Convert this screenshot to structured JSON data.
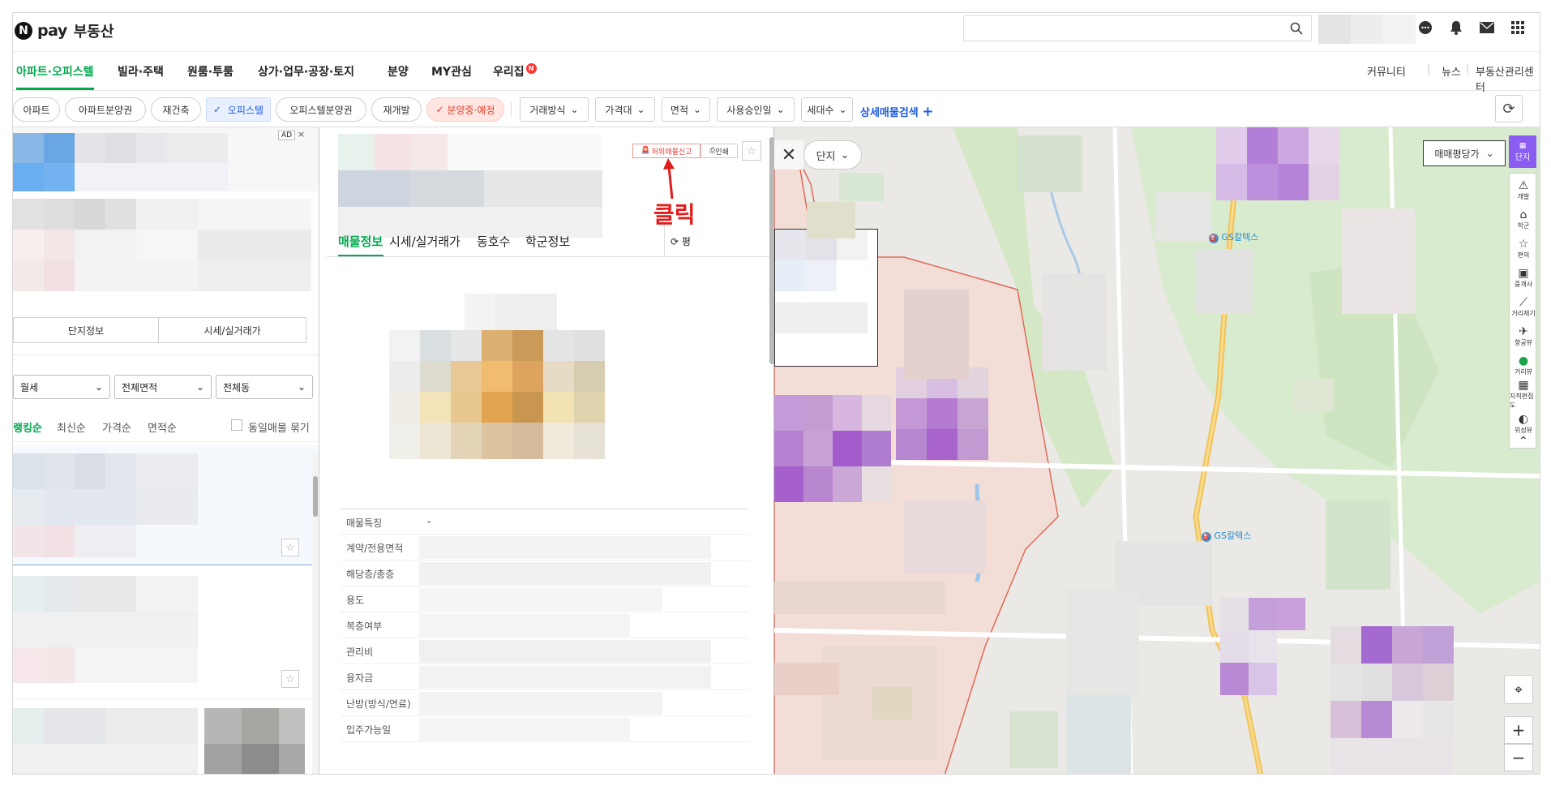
{
  "header": {
    "logo_n": "N",
    "logo_pay": "pay",
    "logo_realty": "부동산",
    "search_placeholder": "",
    "icons": [
      "chat-icon",
      "bell-icon",
      "mail-icon",
      "apps-grid-icon"
    ]
  },
  "menu": {
    "items": [
      "아파트·오피스텔",
      "빌라·주택",
      "원룸·투룸",
      "상가·업무·공장·토지",
      "분양",
      "MY관심",
      "우리집"
    ],
    "badge": "N",
    "right": [
      "커뮤니티",
      "뉴스",
      "부동산관리센터"
    ]
  },
  "filters": {
    "chips": [
      "아파트",
      "아파트분양권",
      "재건축",
      "오피스텔",
      "오피스텔분양권",
      "재개발",
      "분양중·예정"
    ],
    "dropdowns": [
      "거래방식",
      "가격대",
      "면적",
      "사용승인일",
      "세대수"
    ],
    "advanced": "상세매물검색",
    "advanced_plus": "+"
  },
  "left": {
    "ad_label": "AD",
    "ad_close": "×",
    "buttons": [
      "단지정보",
      "시세/실거래가"
    ],
    "selects": [
      "월세",
      "전체면적",
      "전체동"
    ],
    "sort": [
      "랭킹순",
      "최신순",
      "가격순",
      "면적순"
    ],
    "same_listing": "동일매물 묶기"
  },
  "detail": {
    "report": "허위매물신고",
    "print": "인쇄",
    "click_annotation": "클릭",
    "tabs": [
      "매물정보",
      "시세/실거래가",
      "동호수",
      "학군정보"
    ],
    "pyeong": "평",
    "rows": [
      {
        "label": "매물특징",
        "value": "-"
      },
      {
        "label": "계약/전용면적",
        "value": ""
      },
      {
        "label": "해당층/총층",
        "value": ""
      },
      {
        "label": "용도",
        "value": ""
      },
      {
        "label": "복층여부",
        "value": ""
      },
      {
        "label": "관리비",
        "value": ""
      },
      {
        "label": "융자금",
        "value": ""
      },
      {
        "label": "난방(방식/연료)",
        "value": ""
      },
      {
        "label": "입주가능일",
        "value": ""
      }
    ]
  },
  "map": {
    "complex_select": "단지",
    "price_select": "매매평당가",
    "layer_button": "단지",
    "side_tools": [
      "개발",
      "학군",
      "편의",
      "중개사",
      "거리재기",
      "항공뷰",
      "거리뷰",
      "지적편집도",
      "위성뷰"
    ],
    "poi_1": "GS칼텍스",
    "poi_2": "GS칼텍스",
    "zoom_in": "+",
    "zoom_out": "−"
  },
  "colors": {
    "brand_green": "#03a94d",
    "accent_blue": "#1d5be0",
    "annotation_red": "#e21b1b",
    "map_purple": "#a25bd6"
  }
}
